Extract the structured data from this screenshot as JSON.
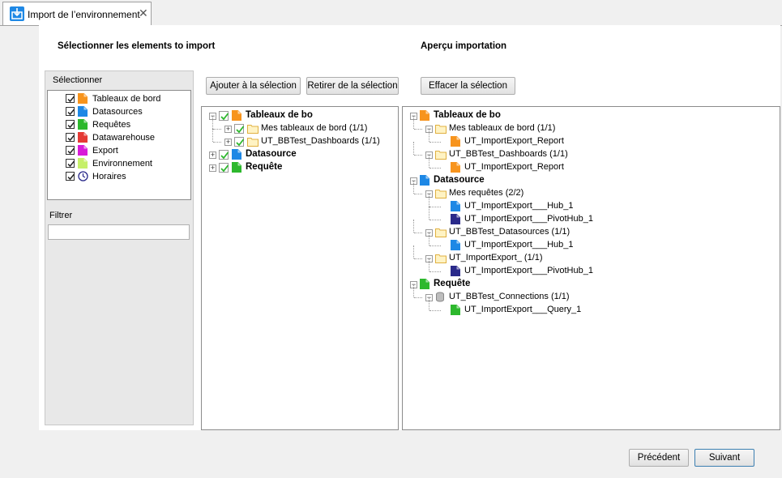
{
  "tab": {
    "title": "Import de l’environnement",
    "close": "✕"
  },
  "left_heading": "Sélectionner les elements to import",
  "right_heading": "Aperçu importation",
  "select_panel": {
    "header": "Sélectionner",
    "items": [
      {
        "label": "Tableaux de bord",
        "checked": true,
        "icon": "dashboard-icon",
        "color": "#f7941d"
      },
      {
        "label": "Datasources",
        "checked": true,
        "icon": "datasource-icon",
        "color": "#1e88e5"
      },
      {
        "label": "Requêtes",
        "checked": true,
        "icon": "query-icon",
        "color": "#2db82d"
      },
      {
        "label": "Datawarehouse",
        "checked": true,
        "icon": "datawarehouse-icon",
        "color": "#e53935"
      },
      {
        "label": "Export",
        "checked": true,
        "icon": "export-icon",
        "color": "#d81bd8"
      },
      {
        "label": "Environnement",
        "checked": true,
        "icon": "environment-icon",
        "color": "#c6f06a"
      },
      {
        "label": "Horaires",
        "checked": true,
        "icon": "clock-icon",
        "color": "#ffffff"
      }
    ],
    "filter_label": "Filtrer",
    "filter_value": ""
  },
  "buttons": {
    "add": "Ajouter à la sélection",
    "remove": "Retirer de la sélection",
    "clear": "Effacer la sélection",
    "previous": "Précédent",
    "next": "Suivant"
  },
  "selection_tree": [
    {
      "label": "Tableaux de bo",
      "bold": true,
      "level": 0,
      "expander": "−",
      "checked": true,
      "icon": "dashboard-icon",
      "color": "#f7941d"
    },
    {
      "label": "Mes tableaux de bord   (1/1)",
      "bold": false,
      "level": 1,
      "expander": "+",
      "checked": true,
      "icon": "folder-icon",
      "color": "#fff3c4"
    },
    {
      "label": "UT_BBTest_Dashboards   (1/1)",
      "bold": false,
      "level": 1,
      "expander": "+",
      "checked": true,
      "icon": "folder-icon",
      "color": "#fff3c4"
    },
    {
      "label": "Datasource",
      "bold": true,
      "level": 0,
      "expander": "+",
      "checked": true,
      "icon": "datasource-icon",
      "color": "#1e88e5"
    },
    {
      "label": "Requête",
      "bold": true,
      "level": 0,
      "expander": "+",
      "checked": true,
      "icon": "query-icon",
      "color": "#2db82d"
    }
  ],
  "preview_tree": [
    {
      "label": "Tableaux de bo",
      "bold": true,
      "level": 0,
      "expander": "−",
      "icon": "dashboard-icon",
      "color": "#f7941d"
    },
    {
      "label": "Mes tableaux de bord   (1/1)",
      "bold": false,
      "level": 1,
      "expander": "−",
      "icon": "folder-icon",
      "color": "#fff3c4"
    },
    {
      "label": "UT_ImportExport_Report",
      "bold": false,
      "level": 2,
      "expander": "",
      "icon": "dashboard-icon",
      "color": "#f7941d"
    },
    {
      "label": "UT_BBTest_Dashboards   (1/1)",
      "bold": false,
      "level": 1,
      "expander": "−",
      "icon": "folder-icon",
      "color": "#fff3c4"
    },
    {
      "label": "UT_ImportExport_Report",
      "bold": false,
      "level": 2,
      "expander": "",
      "icon": "dashboard-icon",
      "color": "#f7941d"
    },
    {
      "label": "Datasource",
      "bold": true,
      "level": 0,
      "expander": "−",
      "icon": "datasource-icon",
      "color": "#1e88e5"
    },
    {
      "label": "Mes requêtes   (2/2)",
      "bold": false,
      "level": 1,
      "expander": "−",
      "icon": "folder-icon",
      "color": "#fff3c4"
    },
    {
      "label": "UT_ImportExport___Hub_1",
      "bold": false,
      "level": 2,
      "expander": "",
      "icon": "datasource-icon",
      "color": "#1e88e5"
    },
    {
      "label": "UT_ImportExport___PivotHub_1",
      "bold": false,
      "level": 2,
      "expander": "",
      "icon": "pivot-datasource-icon",
      "color": "#2a2a8a"
    },
    {
      "label": "UT_BBTest_Datasources   (1/1)",
      "bold": false,
      "level": 1,
      "expander": "−",
      "icon": "folder-icon",
      "color": "#fff3c4"
    },
    {
      "label": "UT_ImportExport___Hub_1",
      "bold": false,
      "level": 2,
      "expander": "",
      "icon": "datasource-icon",
      "color": "#1e88e5"
    },
    {
      "label": "UT_ImportExport_   (1/1)",
      "bold": false,
      "level": 1,
      "expander": "−",
      "icon": "folder-icon",
      "color": "#fff3c4"
    },
    {
      "label": "UT_ImportExport___PivotHub_1",
      "bold": false,
      "level": 2,
      "expander": "",
      "icon": "pivot-datasource-icon",
      "color": "#2a2a8a"
    },
    {
      "label": "Requête",
      "bold": true,
      "level": 0,
      "expander": "−",
      "icon": "query-icon",
      "color": "#2db82d"
    },
    {
      "label": "UT_BBTest_Connections   (1/1)",
      "bold": false,
      "level": 1,
      "expander": "−",
      "icon": "database-icon",
      "color": "#bdbdbd"
    },
    {
      "label": "UT_ImportExport___Query_1",
      "bold": false,
      "level": 2,
      "expander": "",
      "icon": "query-icon",
      "color": "#2db82d"
    }
  ]
}
